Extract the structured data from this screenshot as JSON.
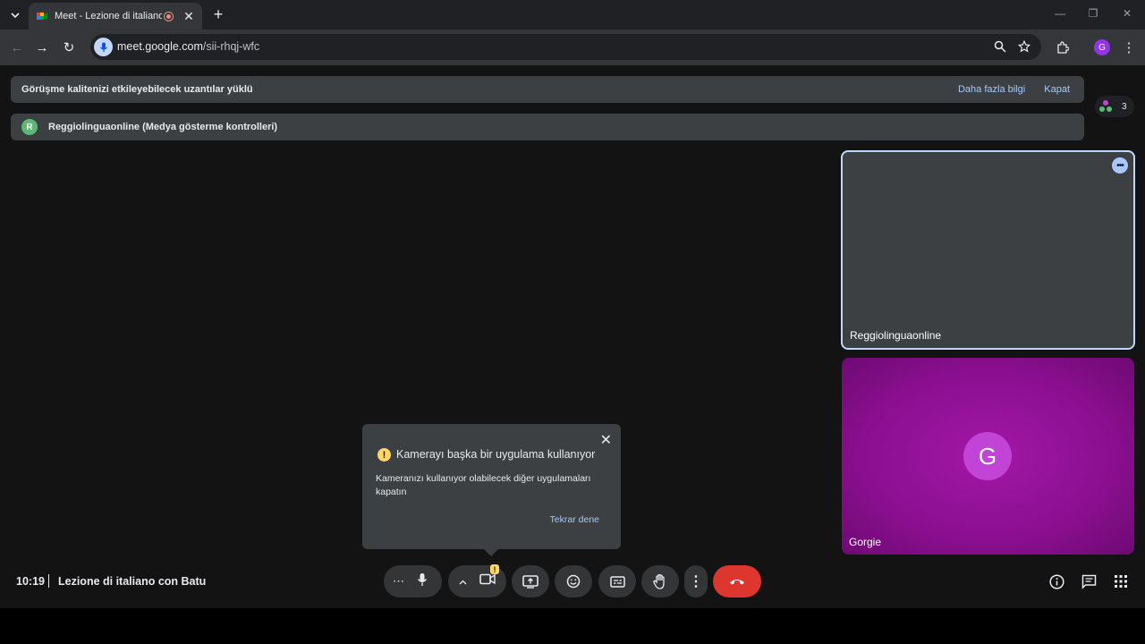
{
  "browser": {
    "tab_title": "Meet - Lezione di italiano c",
    "new_tab": "+",
    "url_main": "meet.google.com",
    "url_path": "/sii-rhqj-wfc",
    "profile_initial": "G"
  },
  "banners": {
    "extensions_text": "Görüşme kalitenizi etkileyebilecek uzantılar yüklü",
    "more_info": "Daha fazla bilgi",
    "close": "Kapat",
    "media_controls_initial": "R",
    "media_controls_text": "Reggiolinguaonline (Medya gösterme kontrolleri)"
  },
  "people_count": "3",
  "tiles": [
    {
      "name": "Reggiolinguaonline"
    },
    {
      "name": "Gorgie",
      "initial": "G"
    }
  ],
  "popup": {
    "title": "Kamerayı başka bir uygulama kullanıyor",
    "body": "Kameranızı kullanıyor olabilecek diğer uygulamaları kapatın",
    "retry": "Tekrar dene"
  },
  "footer": {
    "time": "10:19",
    "meeting_title": "Lezione di italiano con Batu"
  },
  "colors": {
    "accent": "#a8c7fa",
    "end_call": "#dc362e",
    "warning": "#fdd663",
    "tile_purple": "#8a0f8f"
  },
  "icons": [
    "search-icon",
    "bookmark-star-icon",
    "extensions-icon",
    "mic-icon",
    "camera-icon",
    "present-icon",
    "emoji-icon",
    "captions-icon",
    "raise-hand-icon",
    "more-icon",
    "end-call-icon",
    "info-icon",
    "chat-icon",
    "apps-icon"
  ]
}
